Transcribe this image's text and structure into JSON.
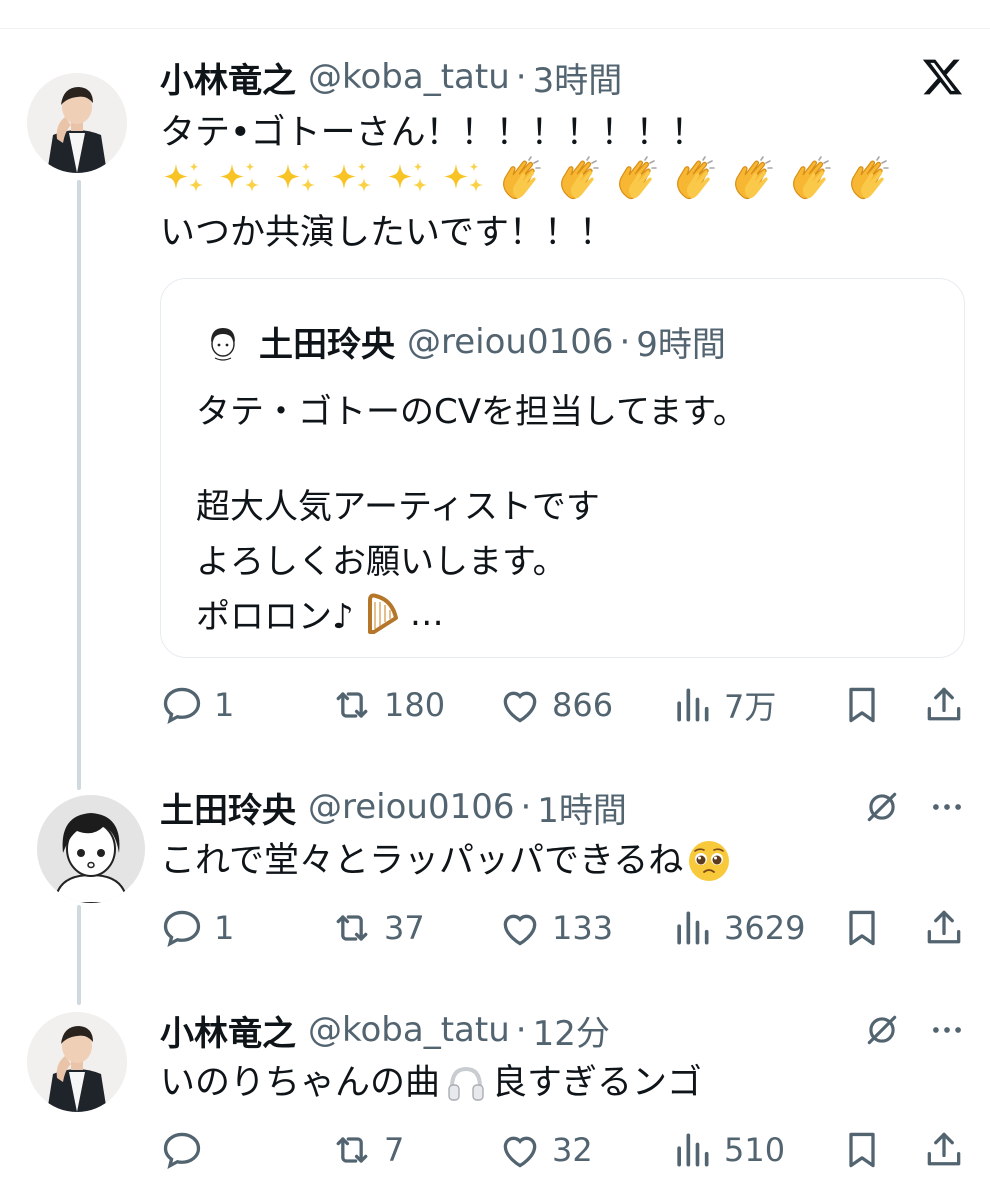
{
  "tweet1": {
    "name": "小林竜之",
    "handle": "@koba_tatu",
    "sep": "·",
    "time": "3時間",
    "line1": "タテ•ゴトーさん！！！！！！！！",
    "line3": "いつか共演したいです！！！",
    "sparkle_count": 6,
    "clap_count": 7,
    "quote": {
      "name": "土田玲央",
      "handle": "@reiou0106",
      "sep": "·",
      "time": "9時間",
      "line1": "タテ・ゴトーのCVを担当してます。",
      "line2": "超大人気アーティストです",
      "line3": "よろしくお願いします。",
      "line4_text": "ポロロン♪",
      "line4_more": "…"
    },
    "actions": {
      "replies": "1",
      "retweets": "180",
      "likes": "866",
      "views": "7万"
    }
  },
  "tweet2": {
    "name": "土田玲央",
    "handle": "@reiou0106",
    "sep": "·",
    "time": "1時間",
    "text": "これで堂々とラッパッパできるね",
    "actions": {
      "replies": "1",
      "retweets": "37",
      "likes": "133",
      "views": "3629"
    }
  },
  "tweet3": {
    "name": "小林竜之",
    "handle": "@koba_tatu",
    "sep": "·",
    "time": "12分",
    "text_before": "いのりちゃんの曲",
    "text_after": "良すぎるンゴ",
    "actions": {
      "replies": "",
      "retweets": "7",
      "likes": "32",
      "views": "510"
    }
  },
  "icons": {
    "x_logo": "x-logo-icon",
    "sparkle": "sparkles-icon",
    "clap": "clapping-hands-icon",
    "harp": "harp-icon",
    "pleading_face": "pleading-face-icon",
    "headphones": "headphones-icon",
    "reply": "reply-icon",
    "retweet": "retweet-icon",
    "like": "heart-icon",
    "views": "views-icon",
    "bookmark": "bookmark-icon",
    "share": "share-icon",
    "grok": "grok-icon",
    "more": "more-icon"
  },
  "colors": {
    "text": "#0f1419",
    "muted": "#536471",
    "border": "#e6ecf0",
    "thread": "#cfd9de"
  }
}
